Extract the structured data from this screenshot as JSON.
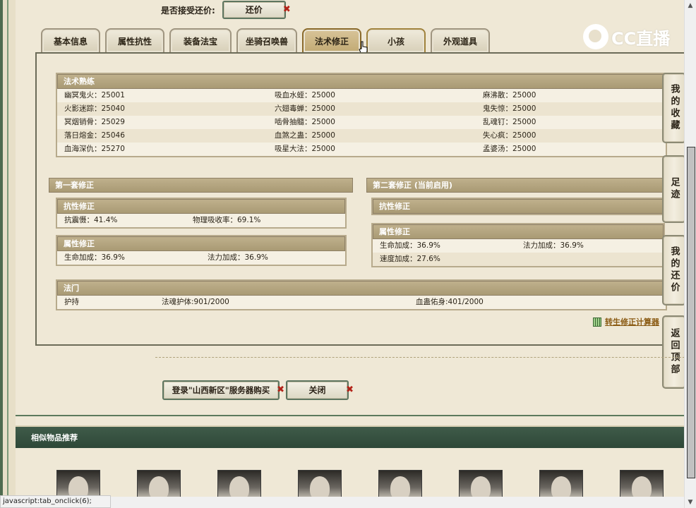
{
  "bargain": {
    "label": "是否接受还价:",
    "button": "还价"
  },
  "tabs": [
    {
      "label": "基本信息"
    },
    {
      "label": "属性抗性"
    },
    {
      "label": "装备法宝"
    },
    {
      "label": "坐骑召唤兽"
    },
    {
      "label": "法术修正"
    },
    {
      "label": "小孩"
    },
    {
      "label": "外观道具"
    }
  ],
  "logo": {
    "text": "CC直播"
  },
  "spell_skill": {
    "title": "法术熟练",
    "rows": [
      [
        "幽冥鬼火：25001",
        "吸血水蛭：25000",
        "麻沸散：25000"
      ],
      [
        "火影迷踪：25040",
        "六翅毒蝉：25000",
        "鬼失惊：25000"
      ],
      [
        "冥烟销骨：25029",
        "啮骨抽髓：25000",
        "乱魂钉：25000"
      ],
      [
        "落日熔金：25046",
        "血煞之蛊：25000",
        "失心疯：25000"
      ],
      [
        "血海深仇：25270",
        "吸星大法：25000",
        "孟婆汤：25000"
      ]
    ]
  },
  "set1": {
    "title": "第一套修正",
    "resist_title": "抗性修正",
    "resist_rows": [
      [
        "抗震慑：41.4%",
        "物理吸收率：69.1%"
      ]
    ],
    "attr_title": "属性修正",
    "attr_rows": [
      [
        "生命加成：36.9%",
        "法力加成：36.9%"
      ]
    ]
  },
  "set2": {
    "title": "第二套修正 (当前启用)",
    "resist_title": "抗性修正",
    "attr_title": "属性修正",
    "attr_rows": [
      [
        "生命加成：36.9%",
        "法力加成：36.9%"
      ],
      [
        "速度加成：27.6%",
        ""
      ]
    ]
  },
  "famen": {
    "title": "法门",
    "row": [
      "护持",
      "法魂护体:901/2000",
      "血蛊佑身:401/2000"
    ]
  },
  "calc_link": "转生修正计算器",
  "side": {
    "fav": "我的收藏",
    "footprint": "足迹",
    "mybargain": "我的还价",
    "top": "返回顶部"
  },
  "buttons": {
    "login": "登录\"山西新区\"服务器购买",
    "close": "关闭"
  },
  "similar": {
    "title": "相似物品推荐"
  },
  "status": "javascript:tab_onclick(6);"
}
